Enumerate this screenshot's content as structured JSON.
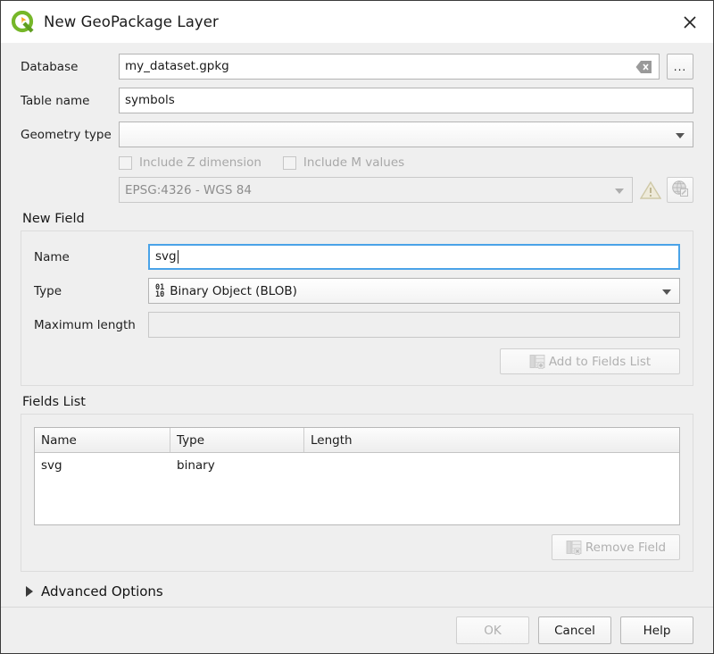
{
  "window": {
    "title": "New GeoPackage Layer",
    "logo_icon": "qgis-logo-icon",
    "close_icon": "close-icon"
  },
  "form": {
    "database": {
      "label": "Database",
      "value": "my_dataset.gpkg",
      "clear_icon": "clear-icon",
      "browse_label": "..."
    },
    "table_name": {
      "label": "Table name",
      "value": "symbols"
    },
    "geometry_type": {
      "label": "Geometry type",
      "value": "",
      "dropdown_icon": "chevron-down-icon"
    },
    "include_z": {
      "label": "Include Z dimension",
      "checked": false
    },
    "include_m": {
      "label": "Include M values",
      "checked": false
    },
    "crs": {
      "value": "EPSG:4326 - WGS 84",
      "dropdown_icon": "chevron-down-icon",
      "warning_icon": "warning-triangle-icon",
      "select_crs_icon": "globe-crs-icon"
    }
  },
  "new_field": {
    "group_title": "New Field",
    "name": {
      "label": "Name",
      "value": "svg"
    },
    "type": {
      "label": "Type",
      "value": "Binary Object (BLOB)",
      "type_icon": "binary-blob-icon",
      "dropdown_icon": "chevron-down-icon"
    },
    "max_length": {
      "label": "Maximum length",
      "value": ""
    },
    "add_button": {
      "label": "Add to Fields List",
      "icon": "add-field-icon"
    }
  },
  "fields_list": {
    "group_title": "Fields List",
    "columns": [
      "Name",
      "Type",
      "Length"
    ],
    "rows": [
      {
        "name": "svg",
        "type": "binary",
        "length": ""
      }
    ],
    "remove_button": {
      "label": "Remove Field",
      "icon": "remove-field-icon"
    }
  },
  "advanced_options": {
    "label": "Advanced Options",
    "expander_icon": "chevron-right-icon",
    "expanded": false
  },
  "footer": {
    "ok_label": "OK",
    "cancel_label": "Cancel",
    "help_label": "Help"
  },
  "colors": {
    "accent": "#4aa3e8",
    "logo_green": "#76b729",
    "logo_orange": "#f5a623",
    "background": "#efefef",
    "titlebar": "#ffffff"
  }
}
